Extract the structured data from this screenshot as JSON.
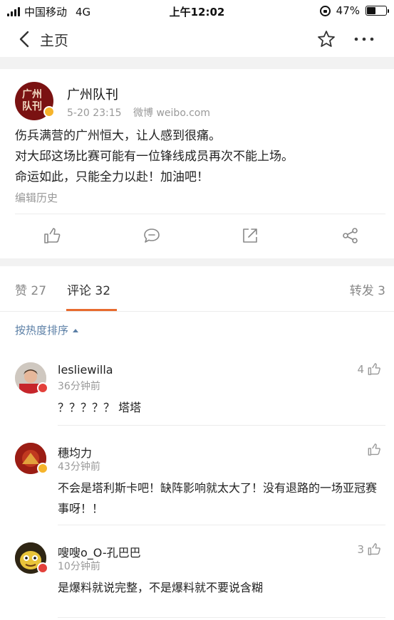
{
  "status_bar": {
    "carrier": "中国移动",
    "network": "4G",
    "time": "上午12:02",
    "battery_percent": "47%",
    "battery_level": 0.47
  },
  "nav": {
    "back_icon": "chevron-left-icon",
    "title": "主页",
    "favorite_icon": "star-icon",
    "more_icon": "more-icon"
  },
  "post": {
    "author": "广州队刊",
    "avatar_text": "广州队刊",
    "time": "5-20 23:15",
    "source": "微博 weibo.com",
    "lines": [
      "伤兵满营的广州恒大，让人感到很痛。",
      "对大邱这场比赛可能有一位锋线成员再次不能上场。",
      "命运如此，只能全力以赴！加油吧！"
    ],
    "edit_history": "编辑历史",
    "actions": [
      "like-icon",
      "comment-icon",
      "repost-icon",
      "share-icon"
    ]
  },
  "tabs": {
    "likes": "赞 27",
    "comments": "评论 32",
    "reposts": "转发 3"
  },
  "comments_section": {
    "sort_label": "按热度排序",
    "items": [
      {
        "name": "lesliewilla",
        "time": "36分钟前",
        "text": "？？？？？ 塔塔",
        "likes": "4"
      },
      {
        "name": "穗均力",
        "time": "43分钟前",
        "text": "不会是塔利斯卡吧！缺阵影响就太大了！没有退路的一场亚冠赛事呀！！",
        "likes": ""
      },
      {
        "name": "嗖嗖o_O-孔巴巴",
        "time": "10分钟前",
        "text": "是爆料就说完整，不是爆料就不要说含糊",
        "likes": "3"
      }
    ]
  },
  "colors": {
    "accent": "#e86b2e",
    "link": "#5b7fa6",
    "verified_gold": "#f6b42b",
    "verified_red": "#e3413b"
  }
}
